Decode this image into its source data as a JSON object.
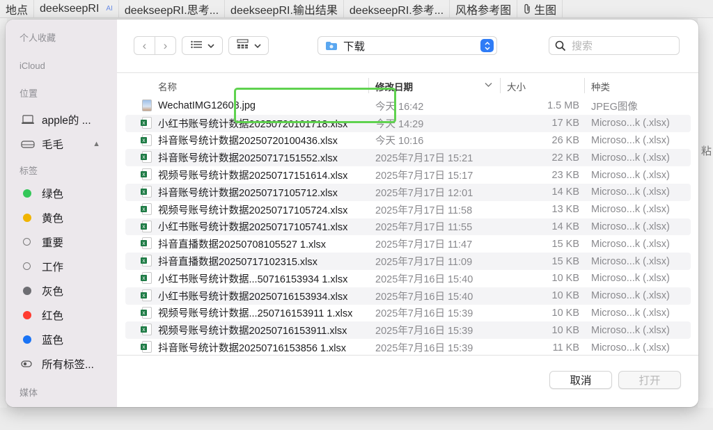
{
  "background": {
    "tabs": [
      "地点",
      "deekseepRI",
      "deekseepRI.思考...",
      "deekseepRI.输出结果",
      "deekseepRI.参考...",
      "风格参考图",
      "生图"
    ],
    "ai_badge": "AI",
    "right_char": "粘"
  },
  "sidebar": {
    "sections": {
      "favorites": "个人收藏",
      "icloud": "iCloud",
      "locations": "位置",
      "tags": "标签",
      "media": "媒体"
    },
    "locations": [
      {
        "label": "apple的 ...",
        "icon": "laptop-icon"
      },
      {
        "label": "毛毛",
        "icon": "drive-icon",
        "eject": "▲"
      }
    ],
    "tags": [
      {
        "label": "绿色",
        "color": "#34c759"
      },
      {
        "label": "黄色",
        "color": "#f0b400"
      },
      {
        "label": "重要",
        "color": ""
      },
      {
        "label": "工作",
        "color": ""
      },
      {
        "label": "灰色",
        "color": "#6d6d72"
      },
      {
        "label": "红色",
        "color": "#ff3b30"
      },
      {
        "label": "蓝色",
        "color": "#1a73f5"
      },
      {
        "label": "所有标签...",
        "color": "all"
      }
    ]
  },
  "toolbar": {
    "back": "‹",
    "forward": "›",
    "location": "下载",
    "search_placeholder": "搜索"
  },
  "columns": {
    "name": "名称",
    "date": "修改日期",
    "size": "大小",
    "kind": "种类"
  },
  "files": [
    {
      "name": "WechatIMG12608.jpg",
      "date": "今天 16:42",
      "size": "1.5 MB",
      "kind": "JPEG图像",
      "type": "jpg"
    },
    {
      "name": "小红书账号统计数据20250720101718.xlsx",
      "date": "今天 14:29",
      "size": "17 KB",
      "kind": "Microso...k (.xlsx)",
      "type": "xlsx"
    },
    {
      "name": "抖音账号统计数据20250720100436.xlsx",
      "date": "今天 10:16",
      "size": "26 KB",
      "kind": "Microso...k (.xlsx)",
      "type": "xlsx"
    },
    {
      "name": "抖音账号统计数据20250717151552.xlsx",
      "date": "2025年7月17日 15:21",
      "size": "22 KB",
      "kind": "Microso...k (.xlsx)",
      "type": "xlsx"
    },
    {
      "name": "视频号账号统计数据20250717151614.xlsx",
      "date": "2025年7月17日 15:17",
      "size": "23 KB",
      "kind": "Microso...k (.xlsx)",
      "type": "xlsx"
    },
    {
      "name": "抖音账号统计数据20250717105712.xlsx",
      "date": "2025年7月17日 12:01",
      "size": "14 KB",
      "kind": "Microso...k (.xlsx)",
      "type": "xlsx"
    },
    {
      "name": "视频号账号统计数据20250717105724.xlsx",
      "date": "2025年7月17日 11:58",
      "size": "13 KB",
      "kind": "Microso...k (.xlsx)",
      "type": "xlsx"
    },
    {
      "name": "小红书账号统计数据20250717105741.xlsx",
      "date": "2025年7月17日 11:55",
      "size": "14 KB",
      "kind": "Microso...k (.xlsx)",
      "type": "xlsx"
    },
    {
      "name": "抖音直播数据20250708105527 1.xlsx",
      "date": "2025年7月17日 11:47",
      "size": "15 KB",
      "kind": "Microso...k (.xlsx)",
      "type": "xlsx"
    },
    {
      "name": "抖音直播数据20250717102315.xlsx",
      "date": "2025年7月17日 11:09",
      "size": "15 KB",
      "kind": "Microso...k (.xlsx)",
      "type": "xlsx"
    },
    {
      "name": "小红书账号统计数据...50716153934 1.xlsx",
      "date": "2025年7月16日 15:40",
      "size": "10 KB",
      "kind": "Microso...k (.xlsx)",
      "type": "xlsx"
    },
    {
      "name": "小红书账号统计数据20250716153934.xlsx",
      "date": "2025年7月16日 15:40",
      "size": "10 KB",
      "kind": "Microso...k (.xlsx)",
      "type": "xlsx"
    },
    {
      "name": "视频号账号统计数据...250716153911 1.xlsx",
      "date": "2025年7月16日 15:39",
      "size": "10 KB",
      "kind": "Microso...k (.xlsx)",
      "type": "xlsx"
    },
    {
      "name": "视频号账号统计数据20250716153911.xlsx",
      "date": "2025年7月16日 15:39",
      "size": "10 KB",
      "kind": "Microso...k (.xlsx)",
      "type": "xlsx"
    },
    {
      "name": "抖音账号统计数据20250716153856 1.xlsx",
      "date": "2025年7月16日 15:39",
      "size": "11 KB",
      "kind": "Microso...k (.xlsx)",
      "type": "xlsx"
    }
  ],
  "buttons": {
    "cancel": "取消",
    "open": "打开"
  },
  "colors": {
    "highlight_border": "#5fd24f",
    "accent": "#2f7cf6",
    "sidebar_bg": "#ece8ec"
  }
}
